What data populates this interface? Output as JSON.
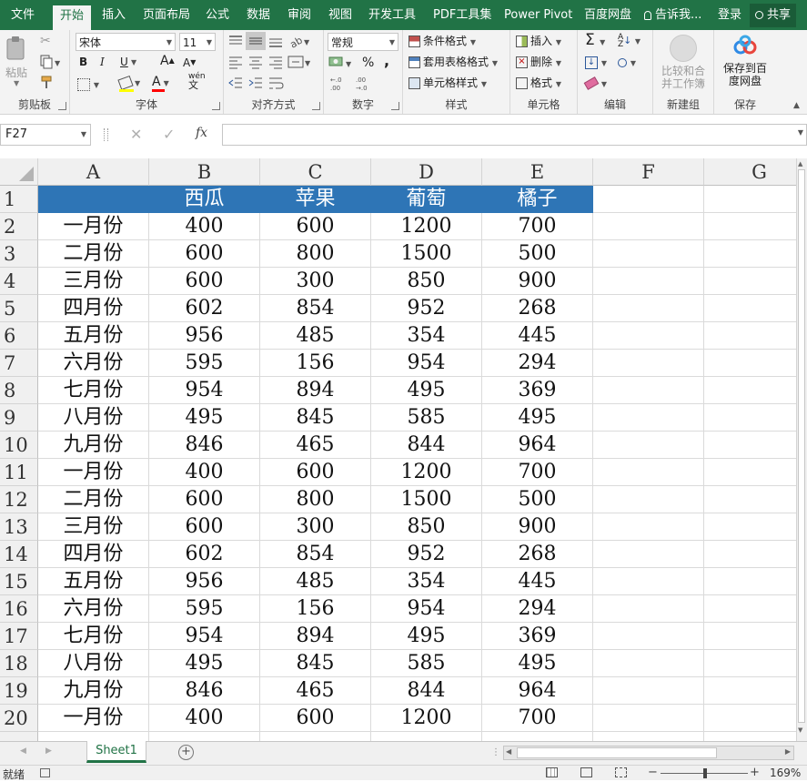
{
  "ribbon_tabs": [
    "文件",
    "开始",
    "插入",
    "页面布局",
    "公式",
    "数据",
    "审阅",
    "视图",
    "开发工具",
    "PDF工具集",
    "Power Pivot",
    "百度网盘"
  ],
  "active_tab": "开始",
  "tell_me": "告诉我...",
  "login": "登录",
  "share": "共享",
  "clipboard": {
    "paste": "粘贴",
    "label": "剪贴板"
  },
  "font": {
    "name": "宋体",
    "size": "11",
    "label": "字体",
    "bold": "B",
    "italic": "I",
    "underline": "U",
    "grow": "A",
    "shrink": "A",
    "phonetic": "wén",
    "font_color_letter": "A"
  },
  "alignment": {
    "label": "对齐方式"
  },
  "number": {
    "format": "常规",
    "label": "数字",
    "percent": "%",
    "comma": ","
  },
  "styles": {
    "conditional": "条件格式",
    "table": "套用表格格式",
    "cell_styles": "单元格样式",
    "label": "样式"
  },
  "cells": {
    "insert": "插入",
    "delete": "删除",
    "format": "格式",
    "label": "单元格"
  },
  "editing": {
    "label": "编辑"
  },
  "newgroup": {
    "compare": "比较和合并工作簿",
    "label": "新建组"
  },
  "save": {
    "button": "保存到百度网盘",
    "label": "保存"
  },
  "formula_bar": {
    "name_box": "F27",
    "fx": "fx",
    "formula": ""
  },
  "columns": [
    "A",
    "B",
    "C",
    "D",
    "E",
    "F",
    "G"
  ],
  "row_numbers": [
    "1",
    "2",
    "3",
    "4",
    "5",
    "6",
    "7",
    "8",
    "9",
    "10",
    "11",
    "12",
    "13",
    "14",
    "15",
    "16",
    "17",
    "18",
    "19",
    "20"
  ],
  "header_row": [
    "",
    "西瓜",
    "苹果",
    "葡萄",
    "橘子"
  ],
  "rows": [
    [
      "一月份",
      "400",
      "600",
      "1200",
      "700"
    ],
    [
      "二月份",
      "600",
      "800",
      "1500",
      "500"
    ],
    [
      "三月份",
      "600",
      "300",
      "850",
      "900"
    ],
    [
      "四月份",
      "602",
      "854",
      "952",
      "268"
    ],
    [
      "五月份",
      "956",
      "485",
      "354",
      "445"
    ],
    [
      "六月份",
      "595",
      "156",
      "954",
      "294"
    ],
    [
      "七月份",
      "954",
      "894",
      "495",
      "369"
    ],
    [
      "八月份",
      "495",
      "845",
      "585",
      "495"
    ],
    [
      "九月份",
      "846",
      "465",
      "844",
      "964"
    ],
    [
      "一月份",
      "400",
      "600",
      "1200",
      "700"
    ],
    [
      "二月份",
      "600",
      "800",
      "1500",
      "500"
    ],
    [
      "三月份",
      "600",
      "300",
      "850",
      "900"
    ],
    [
      "四月份",
      "602",
      "854",
      "952",
      "268"
    ],
    [
      "五月份",
      "956",
      "485",
      "354",
      "445"
    ],
    [
      "六月份",
      "595",
      "156",
      "954",
      "294"
    ],
    [
      "七月份",
      "954",
      "894",
      "495",
      "369"
    ],
    [
      "八月份",
      "495",
      "845",
      "585",
      "495"
    ],
    [
      "九月份",
      "846",
      "465",
      "844",
      "964"
    ],
    [
      "一月份",
      "400",
      "600",
      "1200",
      "700"
    ]
  ],
  "sheet_tabs": [
    "Sheet1"
  ],
  "status": {
    "ready": "就绪",
    "zoom": "169%"
  },
  "colors": {
    "accent": "#217346",
    "header_fill": "#2e75b6"
  }
}
